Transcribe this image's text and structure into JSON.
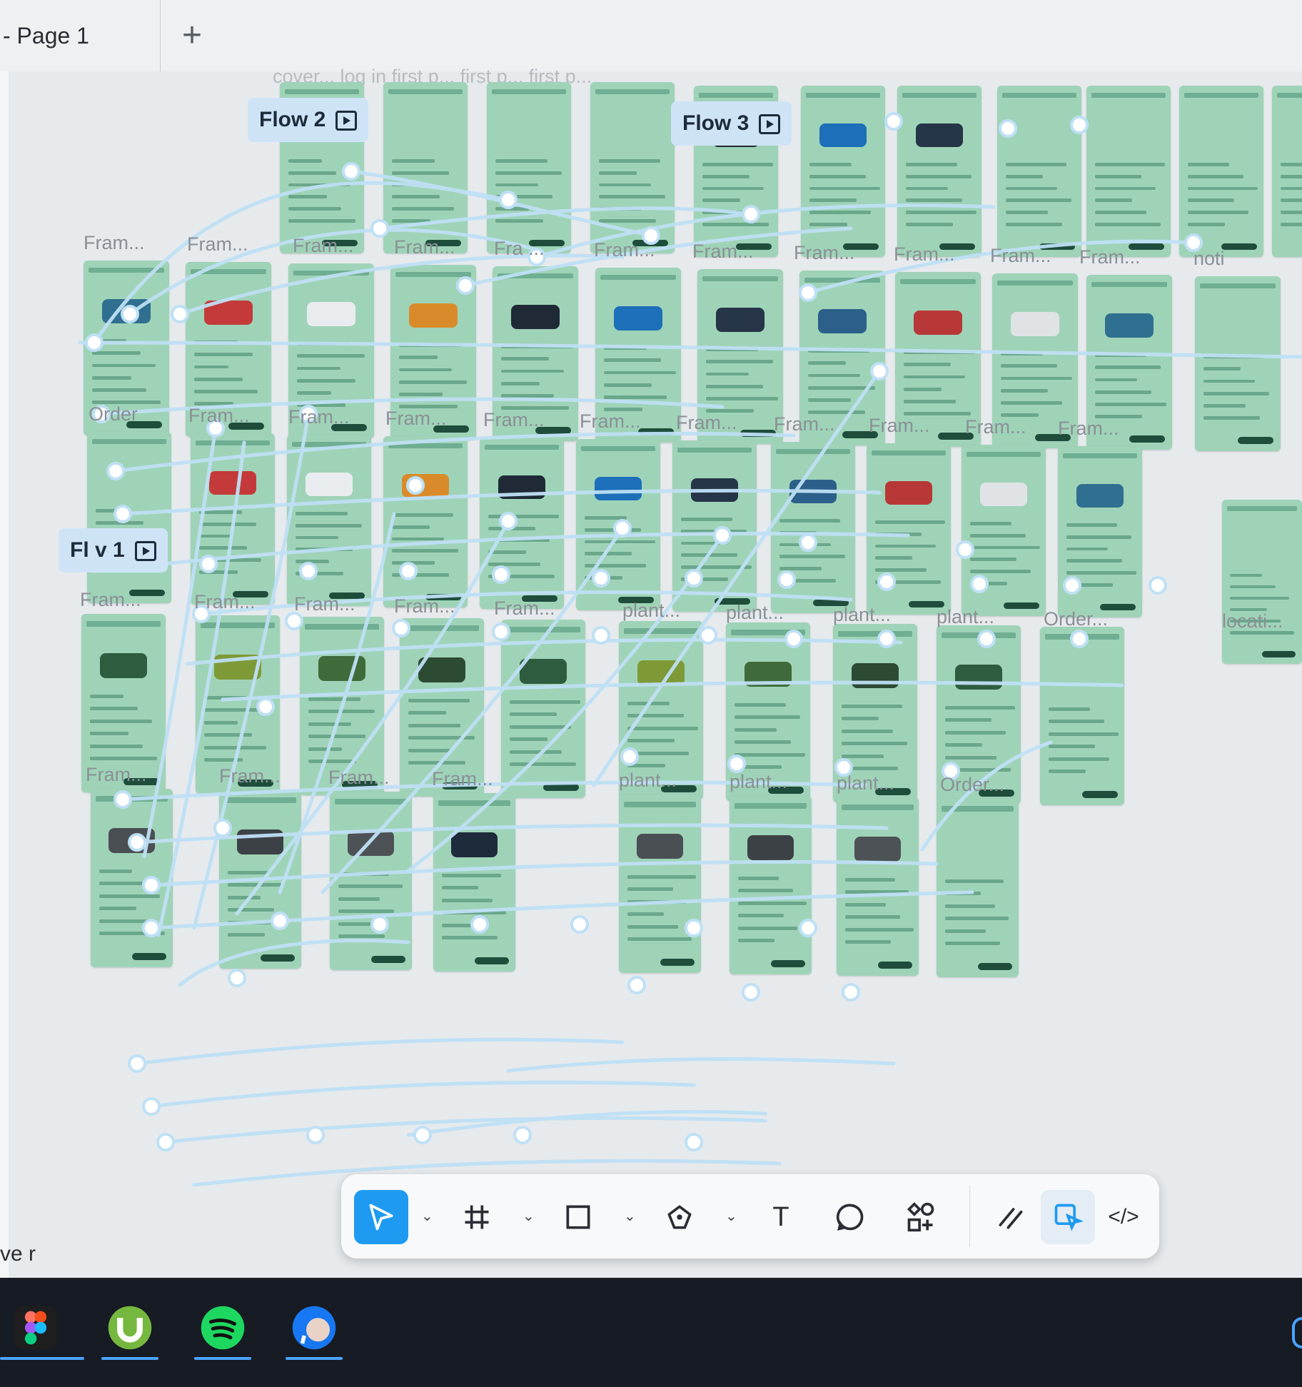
{
  "tabs": {
    "page_label": "- Page 1",
    "add_symbol": "+"
  },
  "flows": [
    {
      "label": "Flow 2"
    },
    {
      "label": "Flow 3"
    },
    {
      "label": "Fl  v 1"
    }
  ],
  "frame_labels": {
    "top_row_ghost": "cover...   log in   first p...   first p...   first p...",
    "row1": [
      "Fram...",
      "Fram...",
      "Fram...",
      "Fram...",
      "Fra  ...",
      "Fram...",
      "Fram...",
      "Fram...",
      "Fram...",
      "Fram...",
      "Fram...",
      "noti"
    ],
    "row2": [
      "Order",
      "Fram...",
      "Fram...",
      "Fram...",
      "Fram...",
      "Fram...",
      "Fram...",
      "Fram...",
      "Fram...",
      "Fram...",
      "Fram..."
    ],
    "row3": [
      "Fram...",
      "Fram...",
      "Fram...",
      "Fram...",
      "Fram...",
      "plant...",
      "plant...",
      "plant...",
      "plant...",
      "Order...",
      "locati..."
    ],
    "row4": [
      "Fram...",
      "Fram...",
      "Fram...",
      "Fram...",
      "plant...",
      "plant...",
      "plant...",
      "Order..."
    ]
  },
  "toolbar": {
    "tools": [
      {
        "icon": "move-cursor-icon",
        "state": "active"
      },
      {
        "icon": "frame-hash-icon"
      },
      {
        "icon": "rectangle-icon"
      },
      {
        "icon": "pen-tool-icon"
      },
      {
        "icon": "text-tool-icon",
        "glyph": "T"
      },
      {
        "icon": "comment-icon"
      },
      {
        "icon": "components-icon"
      },
      {
        "icon": "draw-icon"
      },
      {
        "icon": "prototype-icon",
        "state": "selected"
      },
      {
        "icon": "dev-mode-icon",
        "glyph": "</>"
      }
    ]
  },
  "cut_text": "ve r",
  "taskbar": {
    "apps": [
      {
        "name": "figma",
        "color": "#ff7262"
      },
      {
        "name": "utorrent",
        "color": "#76b83f"
      },
      {
        "name": "spotify",
        "color": "#1ed760"
      },
      {
        "name": "messenger",
        "color": "#1877f2"
      }
    ]
  },
  "colors": {
    "frame_fill": "#9fd3b8",
    "wire": "#bfe0f5",
    "accent": "#1e9bf0",
    "flow_tag": "#cfe3f7"
  },
  "product_colors": [
    "#2f6f8f",
    "#c43a3a",
    "#e9ecee",
    "#d98b2b",
    "#1f2a36",
    "#1c6fb8",
    "#263547",
    "#2c5f8a",
    "#b83737",
    "#dfe3e6"
  ],
  "plant_colors": [
    "#2e5c3e",
    "#7e9a37",
    "#3f6b3a",
    "#2d4a33"
  ],
  "shelf_colors": [
    "#4a4f54",
    "#3c4146",
    "#4d5257",
    "#1e2b3a"
  ]
}
